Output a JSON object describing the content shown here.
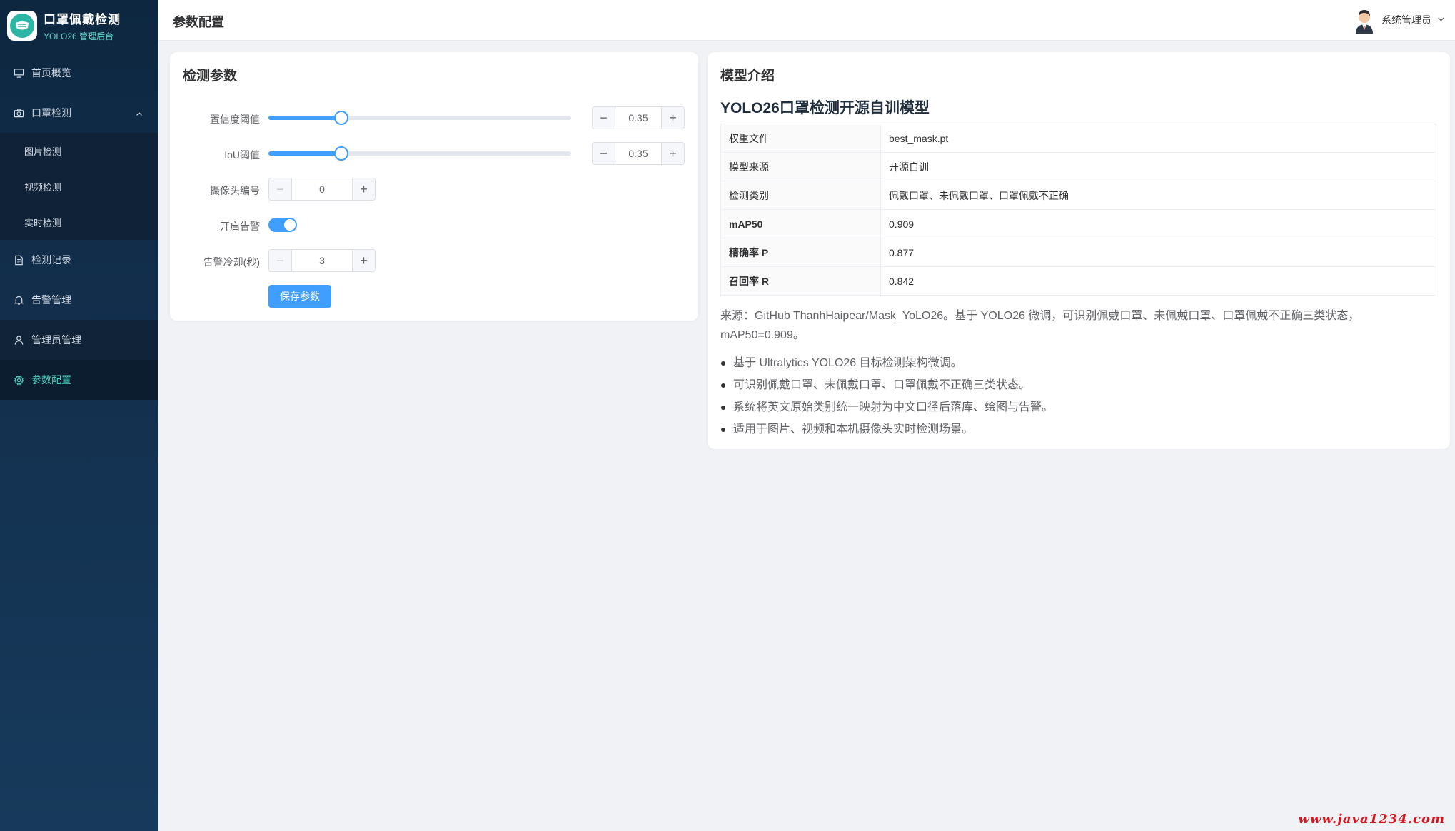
{
  "brand": {
    "title": "口罩佩戴检测",
    "subtitle": "YOLO26 管理后台"
  },
  "sidebar": {
    "items": [
      {
        "label": "首页概览",
        "icon": "presentation-icon"
      },
      {
        "label": "口罩检测",
        "icon": "camera-icon",
        "expanded": true,
        "children": [
          {
            "label": "图片检测"
          },
          {
            "label": "视频检测"
          },
          {
            "label": "实时检测"
          }
        ]
      },
      {
        "label": "检测记录",
        "icon": "document-icon"
      },
      {
        "label": "告警管理",
        "icon": "bell-icon"
      },
      {
        "label": "管理员管理",
        "icon": "user-icon"
      },
      {
        "label": "参数配置",
        "icon": "gear-icon",
        "active": true
      }
    ]
  },
  "header": {
    "page_title": "参数配置",
    "user_name": "系统管理员"
  },
  "params": {
    "title": "检测参数",
    "confidence": {
      "label": "置信度阈值",
      "value": "0.35",
      "fraction": 0.35
    },
    "iou": {
      "label": "IoU阈值",
      "value": "0.35",
      "fraction": 0.35
    },
    "camera": {
      "label": "摄像头编号",
      "value": "0"
    },
    "alarm": {
      "label": "开启告警",
      "enabled": true
    },
    "cooldown": {
      "label": "告警冷却(秒)",
      "value": "3"
    },
    "save_label": "保存参数"
  },
  "model": {
    "title": "模型介绍",
    "name": "YOLO26口罩检测开源自训模型",
    "rows": [
      {
        "key": "权重文件",
        "value": "best_mask.pt"
      },
      {
        "key": "模型来源",
        "value": "开源自训"
      },
      {
        "key": "检测类别",
        "value": "佩戴口罩、未佩戴口罩、口罩佩戴不正确"
      },
      {
        "key": "mAP50",
        "value": "0.909"
      },
      {
        "key": "精确率 P",
        "value": "0.877"
      },
      {
        "key": "召回率 R",
        "value": "0.842"
      }
    ],
    "source": "来源：GitHub ThanhHaipear/Mask_YoLO26。基于 YOLO26 微调，可识别佩戴口罩、未佩戴口罩、口罩佩戴不正确三类状态，mAP50=0.909。",
    "bullets": [
      "基于 Ultralytics YOLO26 目标检测架构微调。",
      "可识别佩戴口罩、未佩戴口罩、口罩佩戴不正确三类状态。",
      "系统将英文原始类别统一映射为中文口径后落库、绘图与告警。",
      "适用于图片、视频和本机摄像头实时检测场景。"
    ]
  },
  "watermark": "www.java1234.com",
  "colors": {
    "primary": "#409eff",
    "sidebar_bg": "#13304e",
    "active_text": "#4ad6c2",
    "brand_sub": "#5fd3c6"
  }
}
